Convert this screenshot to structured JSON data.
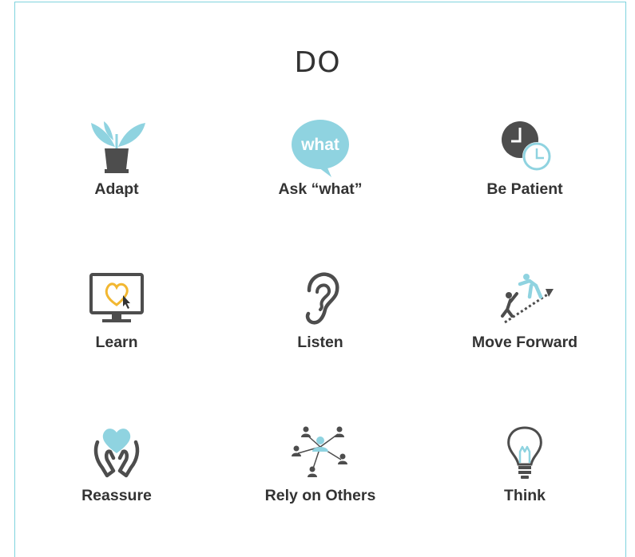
{
  "title": "DO",
  "colors": {
    "dark": "#4d4d4d",
    "accent": "#8fd3e0",
    "yellow": "#f2b731",
    "border": "#7fd3de"
  },
  "items": [
    {
      "label": "Adapt",
      "icon": "plant-icon"
    },
    {
      "label": "Ask “what”",
      "icon": "speech-bubble-icon",
      "bubble_text": "what"
    },
    {
      "label": "Be Patient",
      "icon": "clock-icon"
    },
    {
      "label": "Learn",
      "icon": "monitor-icon"
    },
    {
      "label": "Listen",
      "icon": "ear-icon"
    },
    {
      "label": "Move Forward",
      "icon": "climbing-stairs-icon"
    },
    {
      "label": "Reassure",
      "icon": "hands-heart-icon"
    },
    {
      "label": "Rely on Others",
      "icon": "network-people-icon"
    },
    {
      "label": "Think",
      "icon": "lightbulb-icon"
    }
  ]
}
